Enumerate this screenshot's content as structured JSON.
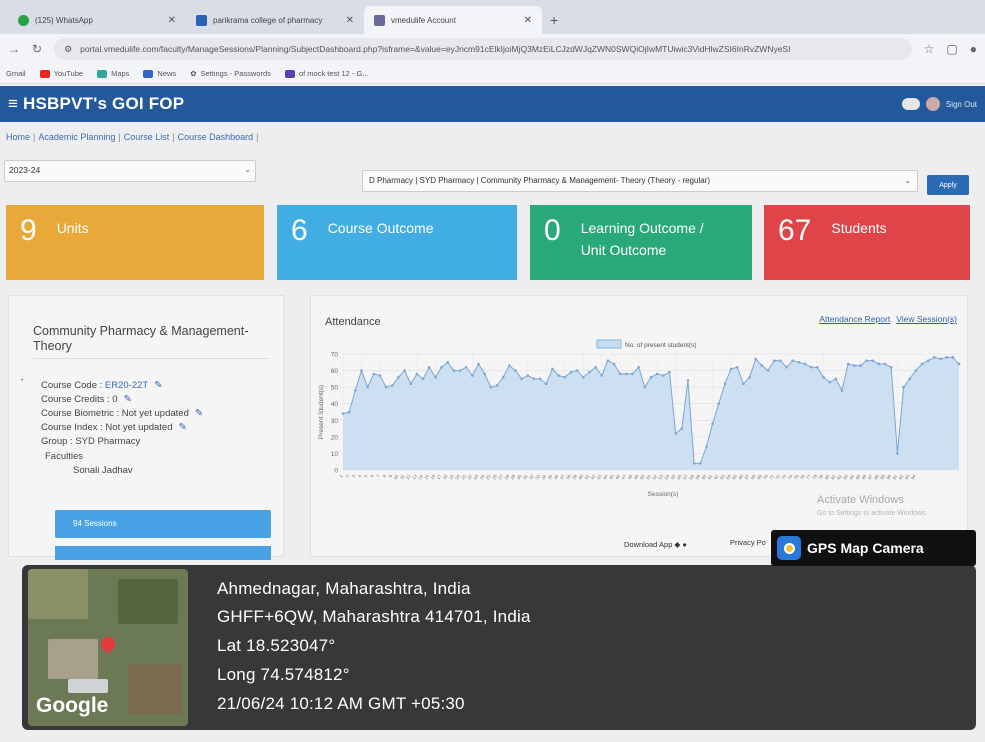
{
  "browser": {
    "tabs": [
      {
        "label": "(125) WhatsApp",
        "color": "#25a244"
      },
      {
        "label": "parikrama college of pharmacy",
        "color": "#2b62b8"
      },
      {
        "label": "vmedulife Account",
        "color": "#6a6a9a"
      }
    ],
    "new_tab": "+",
    "url": "portal.vmedulife.com/faculty/ManageSessions/Planning/SubjectDashboard.php?isframe=&value=eyJncm91cElkIjoiMjQ3MzEiLCJzdWJqZWN0SWQiOjIwMTUiwic3VidHlwZSI6InRvZWNyeSI",
    "bookmarks": [
      {
        "label": "Gmail",
        "color": "#d44"
      },
      {
        "label": "YouTube",
        "color": "#e22"
      },
      {
        "label": "Maps",
        "color": "#3a9"
      },
      {
        "label": "News",
        "color": "#36c"
      },
      {
        "label": "Settings - Passwords",
        "color": "#333"
      },
      {
        "label": "of mock test 12 - G...",
        "color": "#5a3fb5"
      }
    ]
  },
  "app": {
    "title": "≡ HSBPVT's GOI FOP",
    "signout": "Sign Out"
  },
  "breadcrumb": [
    "Home",
    "Academic Planning",
    "Course List",
    "Course Dashboard"
  ],
  "filters": {
    "year": "2023-24",
    "course": "D Pharmacy | SYD Pharmacy | Community Pharmacy & Management- Theory (Theory - regular)",
    "apply": "Apply"
  },
  "cards": [
    {
      "num": "9",
      "label": "Units",
      "color": "#e8a83a"
    },
    {
      "num": "6",
      "label": "Course Outcome",
      "color": "#40aee3"
    },
    {
      "num": "0",
      "label": "Learning Outcome / Unit Outcome",
      "color": "#29a97a"
    },
    {
      "num": "67",
      "label": "Students",
      "color": "#de4448"
    }
  ],
  "course": {
    "title": "Community Pharmacy & Management- Theory",
    "code_label": "Course Code :",
    "code": "ER20-22T",
    "credits": "Course Credits : 0",
    "biometric": "Course Biometric : Not yet updated",
    "index": "Course Index : Not yet updated",
    "group": "Group : SYD Pharmacy",
    "faculties_label": "Faculties",
    "faculty": "Sonali Jadhav",
    "sessions": "94 Sessions"
  },
  "attendance": {
    "title": "Attendance",
    "link_report": "Attendance Report",
    "link_sessions": "View Session(s)"
  },
  "chart_data": {
    "type": "area",
    "legend": "No. of present student(s)",
    "ylabel": "Present Student(s)",
    "xlabel": "Session(s)",
    "ylim": [
      0,
      70
    ],
    "yticks": [
      0,
      10,
      20,
      30,
      40,
      50,
      60,
      70
    ],
    "x": [
      1,
      2,
      3,
      4,
      5,
      6,
      7,
      8,
      9,
      10,
      11,
      12,
      13,
      14,
      15,
      16,
      17,
      18,
      19,
      20,
      21,
      22,
      23,
      24,
      25,
      26,
      27,
      28,
      29,
      30,
      31,
      32,
      33,
      34,
      35,
      36,
      37,
      38,
      39,
      40,
      41,
      42,
      43,
      44,
      45,
      46,
      47,
      48,
      49,
      50,
      51,
      52,
      53,
      54,
      55,
      56,
      57,
      58,
      59,
      60,
      61,
      62,
      63,
      64,
      65,
      66,
      67,
      68,
      69,
      70,
      71,
      72,
      73,
      74,
      75,
      76,
      77,
      78,
      79,
      80,
      81,
      82,
      83,
      84,
      85,
      86,
      87,
      88,
      89,
      90,
      91,
      92,
      93,
      94
    ],
    "values": [
      34,
      35,
      48,
      60,
      50,
      58,
      57,
      50,
      51,
      56,
      60,
      52,
      58,
      55,
      62,
      56,
      62,
      65,
      60,
      60,
      62,
      57,
      64,
      58,
      50,
      51,
      56,
      63,
      60,
      55,
      57,
      55,
      55,
      52,
      61,
      57,
      56,
      59,
      60,
      56,
      59,
      62,
      57,
      66,
      64,
      58,
      58,
      58,
      62,
      50,
      56,
      58,
      57,
      59,
      22,
      25,
      54,
      4,
      4,
      14,
      28,
      40,
      52,
      61,
      62,
      52,
      56,
      67,
      63,
      60,
      66,
      66,
      62,
      66,
      65,
      64,
      62,
      62,
      56,
      53,
      55,
      48,
      64,
      63,
      63,
      66,
      66,
      64,
      64,
      62,
      10,
      50,
      55,
      60,
      64,
      66,
      68,
      67,
      68,
      68,
      64
    ]
  },
  "misc": {
    "activate_title": "Activate Windows",
    "activate_sub": "Go to Settings to activate Windows.",
    "download_app": "Download App",
    "privacy": "Privacy Po"
  },
  "gps": {
    "badge": "GPS Map Camera",
    "map_logo": "Google",
    "line1": "Ahmednagar, Maharashtra, India",
    "line2": "GHFF+6QW, Maharashtra 414701, India",
    "line3": "Lat 18.523047°",
    "line4": "Long 74.574812°",
    "line5": "21/06/24 10:12 AM GMT +05:30"
  }
}
